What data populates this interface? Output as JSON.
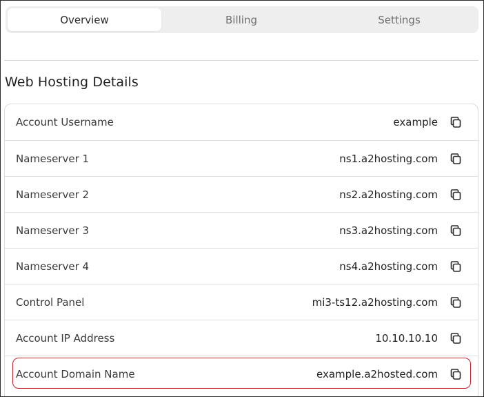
{
  "tabs": [
    {
      "label": "Overview",
      "active": true
    },
    {
      "label": "Billing",
      "active": false
    },
    {
      "label": "Settings",
      "active": false
    }
  ],
  "section": {
    "title": "Web Hosting Details"
  },
  "details": [
    {
      "label": "Account Username",
      "value": "example"
    },
    {
      "label": "Nameserver 1",
      "value": "ns1.a2hosting.com"
    },
    {
      "label": "Nameserver 2",
      "value": "ns2.a2hosting.com"
    },
    {
      "label": "Nameserver 3",
      "value": "ns3.a2hosting.com"
    },
    {
      "label": "Nameserver 4",
      "value": "ns4.a2hosting.com"
    },
    {
      "label": "Control Panel",
      "value": "mi3-ts12.a2hosting.com"
    },
    {
      "label": "Account IP Address",
      "value": "10.10.10.10"
    },
    {
      "label": "Account Domain Name",
      "value": "example.a2hosted.com"
    }
  ],
  "icons": {
    "copy": "copy-icon"
  },
  "colors": {
    "highlight": "#c0202a",
    "tab_background": "#eeeeee",
    "active_tab": "#ffffff"
  }
}
